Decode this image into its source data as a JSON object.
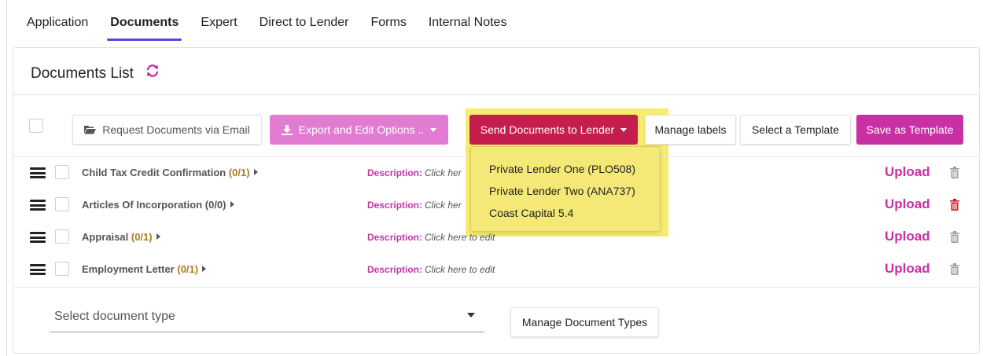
{
  "tabs": [
    {
      "label": "Application"
    },
    {
      "label": "Documents"
    },
    {
      "label": "Expert"
    },
    {
      "label": "Direct to Lender"
    },
    {
      "label": "Forms"
    },
    {
      "label": "Internal Notes"
    }
  ],
  "active_tab": "Documents",
  "card": {
    "title": "Documents List"
  },
  "toolbar": {
    "request_label": "Request Documents via Email",
    "export_label": "Export and Edit Options ..",
    "send_label": "Send Documents to Lender",
    "labels_label": "Manage labels",
    "template_label": "Select a Template",
    "save_template_label": "Save as Template"
  },
  "lender_dropdown": {
    "items": [
      {
        "label": "Private Lender One (PLO508)"
      },
      {
        "label": "Private Lender Two (ANA737)"
      },
      {
        "label": "Coast Capital 5.4"
      }
    ]
  },
  "documents": [
    {
      "name": "Child Tax Credit Confirmation",
      "count": "(0/1)",
      "description_label": "Description:",
      "description_value": "Click her",
      "upload_label": "Upload",
      "trash_color": "#9e9e9e"
    },
    {
      "name": "Articles Of Incorporation",
      "count": "(0/0)",
      "description_label": "Description:",
      "description_value": "Click her",
      "upload_label": "Upload",
      "trash_color": "#d0161e"
    },
    {
      "name": "Appraisal",
      "count": "(0/1)",
      "description_label": "Description:",
      "description_value": "Click here to edit",
      "upload_label": "Upload",
      "trash_color": "#9e9e9e"
    },
    {
      "name": "Employment Letter",
      "count": "(0/1)",
      "description_label": "Description:",
      "description_value": "Click here to edit",
      "upload_label": "Upload",
      "trash_color": "#9e9e9e"
    }
  ],
  "document_type_select": {
    "placeholder": "Select document type"
  },
  "manage_types_label": "Manage Document Types",
  "colors": {
    "accent": "#c830a4",
    "send_button": "#c51d4d",
    "export_button": "#e27cd2",
    "highlight": "#f6ea5e",
    "tab_underline": "#5b47d6"
  },
  "icons": [
    "refresh-icon",
    "folder-open-icon",
    "download-icon",
    "caret-down-icon",
    "drag-handle-icon",
    "caret-right-icon",
    "trash-icon"
  ]
}
